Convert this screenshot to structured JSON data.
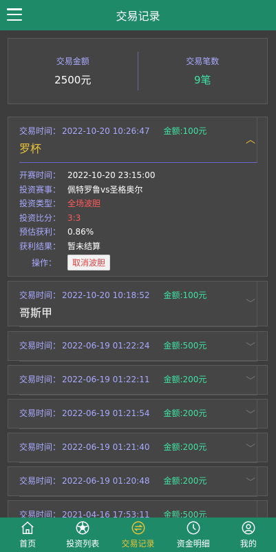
{
  "header": {
    "title": "交易记录"
  },
  "summary": {
    "amount_label": "交易金额",
    "amount_value": "2500元",
    "count_label": "交易笔数",
    "count_value": "9笔"
  },
  "records": [
    {
      "time_label": "交易时间：",
      "time": "2022-10-20 10:26:47",
      "amount": "金额:100元",
      "team": "罗杯",
      "expanded": true,
      "details": {
        "start_label": "开赛时间：",
        "start_value": "2022-10-20 23:15:00",
        "match_label": "投资赛事：",
        "match_value": "佩特罗鲁vs圣格奥尔",
        "type_label": "投资类型：",
        "type_value": "全场波胆",
        "score_label": "投资比分：",
        "score_value": "3:3",
        "profit_label": "预估获利：",
        "profit_value": "0.86%",
        "result_label": "获利结果：",
        "result_value": "暂未结算",
        "op_label": "操作：",
        "cancel_label": "取消波胆"
      }
    },
    {
      "time_label": "交易时间：",
      "time": "2022-10-20 10:18:52",
      "amount": "金额:100元",
      "team": "哥斯甲"
    },
    {
      "time_label": "交易时间：",
      "time": "2022-06-19 01:22:24",
      "amount": "金额:500元"
    },
    {
      "time_label": "交易时间：",
      "time": "2022-06-19 01:22:11",
      "amount": "金额:200元"
    },
    {
      "time_label": "交易时间：",
      "time": "2022-06-19 01:21:54",
      "amount": "金额:200元"
    },
    {
      "time_label": "交易时间：",
      "time": "2022-06-19 01:21:40",
      "amount": "金额:200元"
    },
    {
      "time_label": "交易时间：",
      "time": "2022-06-19 01:20:48",
      "amount": "金额:200元"
    },
    {
      "time_label": "交易时间：",
      "time": "2021-04-16 17:53:11",
      "amount": "金额:500元"
    }
  ],
  "tabs": [
    {
      "label": "首页",
      "icon": "home-icon"
    },
    {
      "label": "投资列表",
      "icon": "ball-icon"
    },
    {
      "label": "交易记录",
      "icon": "transfer-icon",
      "active": true
    },
    {
      "label": "资金明细",
      "icon": "clock-icon"
    },
    {
      "label": "我的",
      "icon": "user-icon"
    }
  ],
  "colors": {
    "header_bg": "#1f8a68",
    "accent_green": "#3ee2a6",
    "label_purple": "#a9a9ff",
    "active_yellow": "#e7c23a",
    "danger_red": "#ff5a5a"
  }
}
